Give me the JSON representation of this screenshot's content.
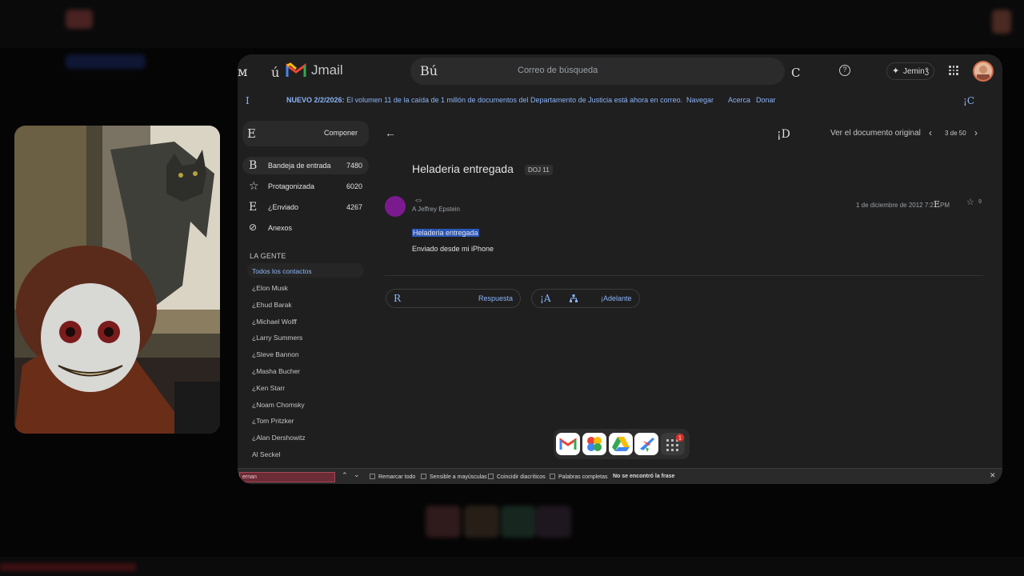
{
  "brand": {
    "glyph": "ú",
    "name": "Jmail",
    "left_glyph": "м"
  },
  "topbar": {
    "search_glyph": "Bú",
    "search_placeholder": "Correo de búsqueda",
    "search_trailing_glyph": "C",
    "help_icon": "?",
    "gemini_label": "Jeminǯ"
  },
  "banner": {
    "lead_glyph": "I",
    "prefix": "NUEVO 2/2/2026:",
    "text": "El volumen 11 de la caída de 1 millón de documentos del Departamento de Justicia está ahora en correo.",
    "links": [
      "Navegar",
      "Acerca",
      "Donar"
    ],
    "trailing_glyph": "¡C"
  },
  "sidebar": {
    "compose_glyph": "E",
    "compose_label": "Componer",
    "items": [
      {
        "glyph": "B",
        "label": "Bandeja de entrada",
        "count": "7480"
      },
      {
        "glyph": "☆",
        "label": "Protagonizada",
        "count": "6020"
      },
      {
        "glyph": "E",
        "label": "¿Enviado",
        "count": "4267"
      },
      {
        "glyph": "⊘",
        "label": "Anexos",
        "count": ""
      }
    ],
    "people_title": "LA GENTE",
    "contacts": [
      "Todos los contactos",
      "¿Elon Musk",
      "¿Ehud Barak",
      "¿Michael Wolff",
      "¿Larry Summers",
      "¿Steve Bannon",
      "¿Masha Bucher",
      "¿Ken Starr",
      "¿Noam Chomsky",
      "¿Tom Pritzker",
      "¿Alan Dershowitz",
      "Al Seckel"
    ]
  },
  "message_toolbar": {
    "center_glyph": "¡D",
    "view_original": "Ver el documento original",
    "pager": "3 de 50"
  },
  "message": {
    "subject": "Heladeria entregada",
    "tag": "DOJ 11",
    "sender": "<>",
    "to": "A Jeffrey Epstein",
    "date": "1 de diciembre de 2012 7:2",
    "date_glyph": "E",
    "date_suffix": "PM",
    "star_count": "9",
    "body_line1": "Heladeria entregada",
    "body_line2": "Enviado desde mi iPhone"
  },
  "actions": {
    "reply_glyph": "R",
    "reply_label": "Respuesta",
    "forward_glyph": "¡A",
    "forward_label": "¡Adelante"
  },
  "dock": {
    "badge": "1"
  },
  "findbar": {
    "query": "ernan",
    "options": [
      "Remarcar todo",
      "Sensible a mayúsculas",
      "Coincidir diacríticos",
      "Palabras completas"
    ],
    "status": "No se encontró la frase"
  },
  "colors": {
    "background": "#1f1f1f",
    "link": "#8ab4f8",
    "avatar_purple": "#7b1a8f",
    "selection": "#2a57b8"
  }
}
